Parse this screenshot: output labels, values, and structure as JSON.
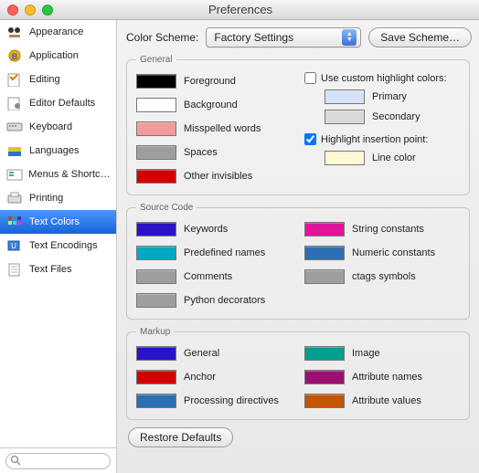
{
  "window": {
    "title": "Preferences"
  },
  "sidebar": {
    "items": [
      {
        "label": "Appearance"
      },
      {
        "label": "Application"
      },
      {
        "label": "Editing"
      },
      {
        "label": "Editor Defaults"
      },
      {
        "label": "Keyboard"
      },
      {
        "label": "Languages"
      },
      {
        "label": "Menus & Shortcuts"
      },
      {
        "label": "Printing"
      },
      {
        "label": "Text Colors"
      },
      {
        "label": "Text Encodings"
      },
      {
        "label": "Text Files"
      }
    ],
    "selected_index": 8,
    "search_placeholder": ""
  },
  "scheme": {
    "label": "Color Scheme:",
    "value": "Factory Settings",
    "save_button": "Save Scheme…"
  },
  "groups": {
    "general": {
      "legend": "General",
      "left": [
        {
          "label": "Foreground",
          "color": "#000000"
        },
        {
          "label": "Background",
          "color": "#ffffff"
        },
        {
          "label": "Misspelled words",
          "color": "#f29b9b"
        },
        {
          "label": "Spaces",
          "color": "#9e9e9e"
        },
        {
          "label": "Other invisibles",
          "color": "#d40000"
        }
      ],
      "right": {
        "use_custom": {
          "label": "Use custom highlight colors:",
          "checked": false
        },
        "primary": {
          "label": "Primary",
          "color": "#d4e3fa"
        },
        "secondary": {
          "label": "Secondary",
          "color": "#d9d9d9"
        },
        "highlight_insertion": {
          "label": "Highlight insertion point:",
          "checked": true
        },
        "line_color": {
          "label": "Line color",
          "color": "#fef8d3"
        }
      }
    },
    "source": {
      "legend": "Source Code",
      "left": [
        {
          "label": "Keywords",
          "color": "#2a12c9"
        },
        {
          "label": "Predefined names",
          "color": "#00a9c2"
        },
        {
          "label": "Comments",
          "color": "#9e9e9e"
        },
        {
          "label": "Python decorators",
          "color": "#9e9e9e"
        }
      ],
      "right": [
        {
          "label": "String constants",
          "color": "#e2149a"
        },
        {
          "label": "Numeric constants",
          "color": "#2d6fb3"
        },
        {
          "label": "ctags symbols",
          "color": "#9e9e9e"
        }
      ]
    },
    "markup": {
      "legend": "Markup",
      "left": [
        {
          "label": "General",
          "color": "#2a12c9"
        },
        {
          "label": "Anchor",
          "color": "#d40000"
        },
        {
          "label": "Processing directives",
          "color": "#2d6fb3"
        }
      ],
      "right": [
        {
          "label": "Image",
          "color": "#009e8e"
        },
        {
          "label": "Attribute names",
          "color": "#9c0f6f"
        },
        {
          "label": "Attribute values",
          "color": "#c45400"
        }
      ]
    }
  },
  "footer": {
    "restore": "Restore Defaults"
  }
}
